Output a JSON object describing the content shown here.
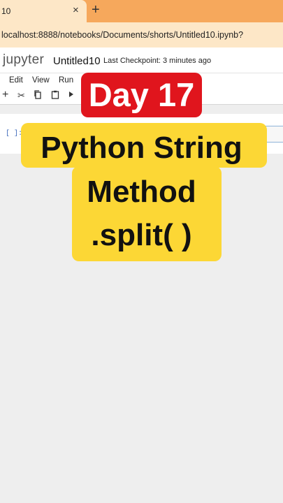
{
  "browser": {
    "tab_title": "10",
    "tab_close": "×",
    "new_tab": "+",
    "url": "localhost:8888/notebooks/Documents/shorts/Untitled10.ipynb?"
  },
  "jupyter": {
    "logo": "jupyter",
    "notebook_title": "Untitled10",
    "checkpoint": "Last Checkpoint: 3 minutes ago",
    "menu": [
      "Edit",
      "View",
      "Run"
    ],
    "toolbar_icons": [
      "add-cell-icon",
      "cut-icon",
      "copy-icon",
      "paste-icon",
      "run-icon"
    ],
    "cell_prompt": "[ ]:"
  },
  "overlay": {
    "day": "Day 17",
    "line1": "Python String",
    "line2": "Method",
    "line3": ".split( )"
  },
  "colors": {
    "tab_strip": "#f6a85c",
    "badge_red": "#e0151d",
    "highlight_yellow": "#fcd735"
  }
}
